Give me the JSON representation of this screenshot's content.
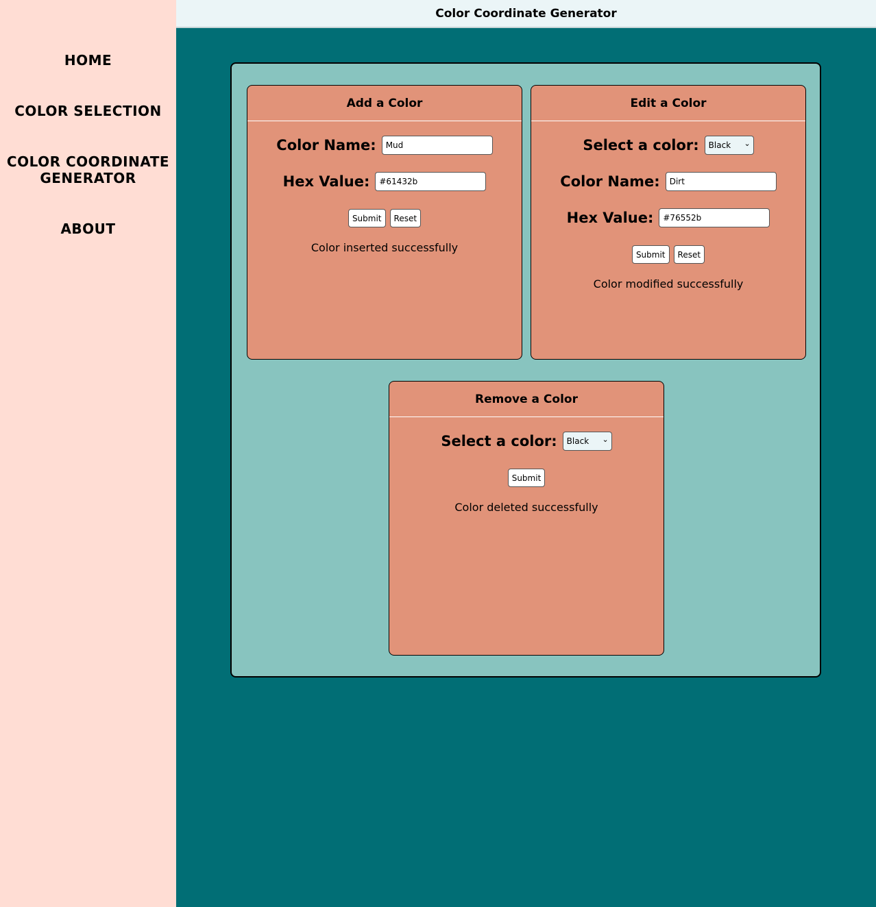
{
  "nav": {
    "home": "HOME",
    "color_selection": "COLOR SELECTION",
    "generator_line1": "COLOR COORDINATE",
    "generator_line2": "GENERATOR",
    "about": "ABOUT"
  },
  "header": {
    "title": "Color Coordinate Generator"
  },
  "add_card": {
    "title": "Add a Color",
    "name_label": "Color Name:",
    "name_value": "Mud",
    "hex_label": "Hex Value:",
    "hex_value": "#61432b",
    "submit": "Submit",
    "reset": "Reset",
    "message": "Color inserted successfully"
  },
  "edit_card": {
    "title": "Edit a Color",
    "select_label": "Select a color:",
    "select_value": "Black",
    "name_label": "Color Name:",
    "name_value": "Dirt",
    "hex_label": "Hex Value:",
    "hex_value": "#76552b",
    "submit": "Submit",
    "reset": "Reset",
    "message": "Color modified successfully"
  },
  "remove_card": {
    "title": "Remove a Color",
    "select_label": "Select a color:",
    "select_value": "Black",
    "submit": "Submit",
    "message": "Color deleted successfully"
  },
  "colors": {
    "sidebar_bg": "#ffddd4",
    "page_bg": "#016e75",
    "panel_bg": "#88c4bf",
    "card_bg": "#e19379",
    "header_bg": "#ebf5f7"
  }
}
